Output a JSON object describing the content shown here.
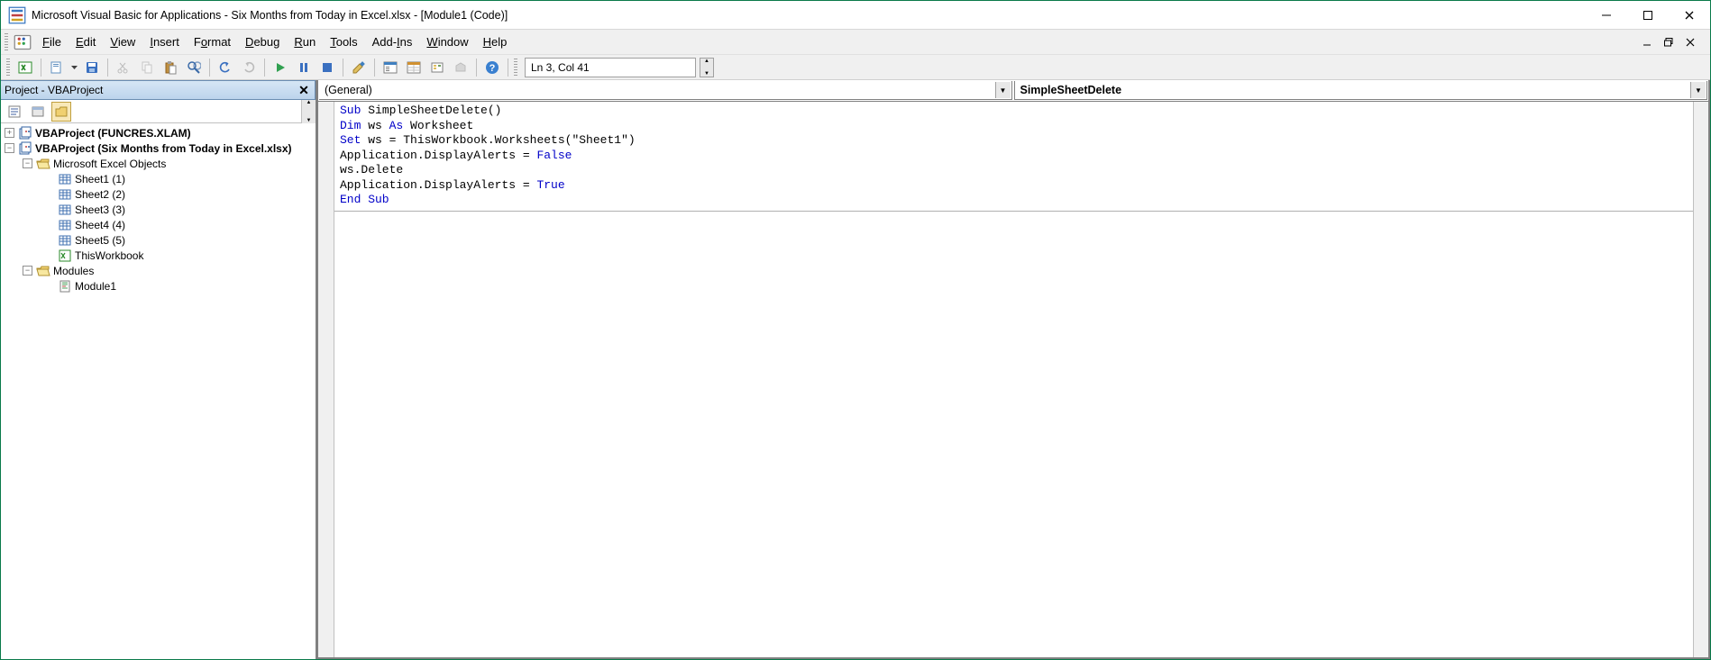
{
  "title": "Microsoft Visual Basic for Applications - Six Months from Today in Excel.xlsx - [Module1 (Code)]",
  "menu": [
    "File",
    "Edit",
    "View",
    "Insert",
    "Format",
    "Debug",
    "Run",
    "Tools",
    "Add-Ins",
    "Window",
    "Help"
  ],
  "menu_accel_index": [
    0,
    0,
    0,
    0,
    1,
    0,
    0,
    0,
    4,
    0,
    0
  ],
  "status_pos": "Ln 3, Col 41",
  "project": {
    "title": "Project - VBAProject",
    "tree": {
      "root1": "VBAProject (FUNCRES.XLAM)",
      "root2": "VBAProject (Six Months from Today in Excel.xlsx)",
      "excel_objects": "Microsoft Excel Objects",
      "sheets": [
        "Sheet1 (1)",
        "Sheet2 (2)",
        "Sheet3 (3)",
        "Sheet4 (4)",
        "Sheet5 (5)"
      ],
      "this_workbook": "ThisWorkbook",
      "modules_folder": "Modules",
      "module": "Module1"
    }
  },
  "combo_left": "(General)",
  "combo_right": "SimpleSheetDelete",
  "code_tokens": [
    [
      {
        "t": "Sub ",
        "c": "kw"
      },
      {
        "t": "SimpleSheetDelete()",
        "c": ""
      }
    ],
    [
      {
        "t": "Dim ",
        "c": "kw"
      },
      {
        "t": "ws ",
        "c": ""
      },
      {
        "t": "As ",
        "c": "kw"
      },
      {
        "t": "Worksheet",
        "c": ""
      }
    ],
    [
      {
        "t": "Set ",
        "c": "kw"
      },
      {
        "t": "ws = ThisWorkbook.Worksheets(\"Sheet1\")",
        "c": ""
      }
    ],
    [
      {
        "t": "Application.DisplayAlerts = ",
        "c": ""
      },
      {
        "t": "False",
        "c": "kw"
      }
    ],
    [
      {
        "t": "ws.Delete",
        "c": ""
      }
    ],
    [
      {
        "t": "Application.DisplayAlerts = ",
        "c": ""
      },
      {
        "t": "True",
        "c": "kw"
      }
    ],
    [
      {
        "t": "End Sub",
        "c": "kw"
      }
    ]
  ]
}
